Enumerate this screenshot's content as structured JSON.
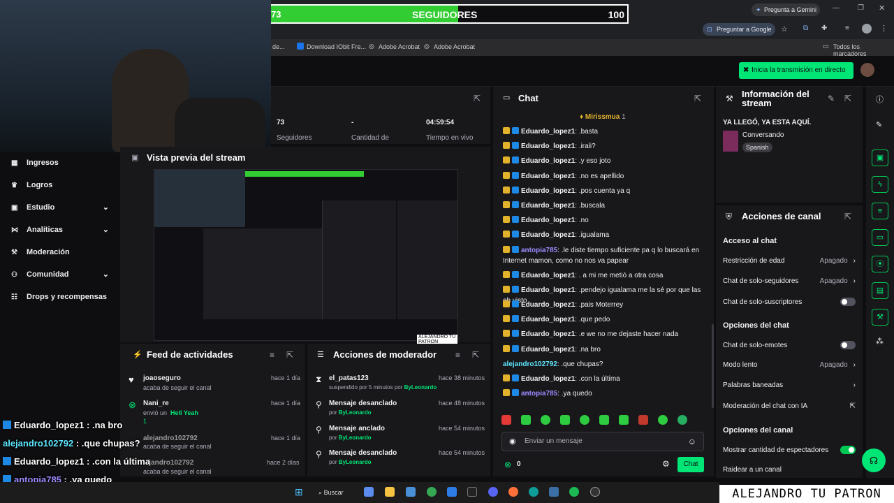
{
  "browser": {
    "gemini_button": "Pregunta a Gemini",
    "google_button": "Preguntar a Google",
    "bookmarks": [
      "de...",
      "Download IObit Fre...",
      "Adobe Acrobat",
      "Adobe Acrobat"
    ],
    "all_bookmarks": "Todos los marcadores"
  },
  "follower_goal": {
    "current": "73",
    "label": "SEGUIDORES",
    "target": "100",
    "progress": 0.73
  },
  "header": {
    "start_stream_button": "Inicia la transmisión en directo"
  },
  "stats": [
    {
      "value": "73",
      "label": "Seguidores"
    },
    {
      "value": "-",
      "label": "Cantidad de"
    },
    {
      "value": "04:59:54",
      "label": "Tiempo en vivo"
    }
  ],
  "preview": {
    "title": "Vista previa del stream",
    "watermark": "ALEJANDRO TU PATRON"
  },
  "sidebar": {
    "items": [
      {
        "label": "Ingresos"
      },
      {
        "label": "Logros"
      },
      {
        "label": "Estudio"
      },
      {
        "label": "Analíticas"
      },
      {
        "label": "Moderación"
      },
      {
        "label": "Comunidad"
      },
      {
        "label": "Drops y recompensas"
      }
    ]
  },
  "activity": {
    "title": "Feed de actividades",
    "items": [
      {
        "name": "joaoseguro",
        "action": "acaba de seguir el canal",
        "time": "hace 1 día"
      },
      {
        "name": "Nani_re",
        "action": "envió un",
        "highlight": "Hell Yeah",
        "points": "1",
        "time": "hace 1 día"
      },
      {
        "name": "alejandro102792",
        "action": "acaba de seguir el canal",
        "time": "hace 1 día"
      },
      {
        "name": "...jandro102792",
        "action": "acaba de seguir el canal",
        "time": "hace 2 días"
      }
    ]
  },
  "mod_actions": {
    "title": "Acciones de moderador",
    "items": [
      {
        "name": "el_patas123",
        "detail": "suspendido por 5 minutos por",
        "by": "ByLeonardo",
        "time": "hace 38 minutos"
      },
      {
        "name": "Mensaje desanclado",
        "detail": "por",
        "by": "ByLeonardo",
        "time": "hace 48 minutos"
      },
      {
        "name": "Mensaje anclado",
        "detail": "por",
        "by": "ByLeonardo",
        "time": "hace 54 minutos"
      },
      {
        "name": "Mensaje desanclado",
        "detail": "por",
        "by": "ByLeonardo",
        "time": "hace 54 minutos"
      }
    ]
  },
  "chat": {
    "title": "Chat",
    "top_gifter": "Mirissmua",
    "top_gifter_count": "1",
    "messages": [
      {
        "badge": "gold",
        "user": "Eduardo_lopez1",
        "color": "#efeff1",
        "text": ": .basta"
      },
      {
        "badge": "gold",
        "user": "Eduardo_lopez1",
        "color": "#efeff1",
        "text": ": .irali?"
      },
      {
        "badge": "gold",
        "user": "Eduardo_lopez1",
        "color": "#efeff1",
        "text": ": .y eso joto"
      },
      {
        "badge": "gold",
        "user": "Eduardo_lopez1",
        "color": "#efeff1",
        "text": ": .no es apellido"
      },
      {
        "badge": "gold",
        "user": "Eduardo_lopez1",
        "color": "#efeff1",
        "text": ": .pos cuenta ya q"
      },
      {
        "badge": "gold",
        "user": "Eduardo_lopez1",
        "color": "#efeff1",
        "text": ": .buscala"
      },
      {
        "badge": "gold",
        "user": "Eduardo_lopez1",
        "color": "#efeff1",
        "text": ": .no"
      },
      {
        "badge": "gold",
        "user": "Eduardo_lopez1",
        "color": "#efeff1",
        "text": ": .igualama"
      },
      {
        "badge": "gold",
        "user": "antopia785",
        "color": "#9b8cff",
        "text": ": .le diste tiempo suficiente pa q lo buscará en Internet mamon, como no nos va papear"
      },
      {
        "badge": "gold",
        "user": "Eduardo_lopez1",
        "color": "#efeff1",
        "text": ": . a mi me metió a otra cosa"
      },
      {
        "badge": "gold",
        "user": "Eduardo_lopez1",
        "color": "#efeff1",
        "text": ": .pendejo igualama me la sé por que las eh visto"
      },
      {
        "badge": "gold",
        "user": "Eduardo_lopez1",
        "color": "#efeff1",
        "text": ": .pais Moterrey"
      },
      {
        "badge": "gold",
        "user": "Eduardo_lopez1",
        "color": "#efeff1",
        "text": ": .que pedo"
      },
      {
        "badge": "gold",
        "user": "Eduardo_lopez1",
        "color": "#efeff1",
        "text": ": .e we no me dejaste hacer nada"
      },
      {
        "badge": "gold",
        "user": "Eduardo_lopez1",
        "color": "#efeff1",
        "text": ": .na bro"
      },
      {
        "badge": "none",
        "user": "alejandro102792",
        "color": "#5ee8ff",
        "text": ": .que chupas?"
      },
      {
        "badge": "gold",
        "user": "Eduardo_lopez1",
        "color": "#efeff1",
        "text": ": .con la última"
      },
      {
        "badge": "gold",
        "user": "antopia785",
        "color": "#9b8cff",
        "text": ": .ya quedo"
      }
    ],
    "input_placeholder": "Enviar un mensaje",
    "points": "0",
    "send_button": "Chat"
  },
  "stream_info": {
    "title": "Información del stream",
    "stream_title": "YA LLEGÓ, YA ESTA AQUÍ.",
    "category": "Conversando",
    "language": "Spanish"
  },
  "channel_actions": {
    "title": "Acciones de canal",
    "sections": [
      {
        "heading": "Acceso al chat"
      },
      {
        "heading": "Opciones del chat"
      },
      {
        "heading": "Opciones del canal"
      }
    ],
    "age_restriction": {
      "label": "Restricción de edad",
      "value": "Apagado"
    },
    "followers_only": {
      "label": "Chat de solo-seguidores",
      "value": "Apagado"
    },
    "subs_only": {
      "label": "Chat de solo-suscriptores",
      "on": false
    },
    "emote_only": {
      "label": "Chat de solo-emotes",
      "on": false
    },
    "slow_mode": {
      "label": "Modo lento",
      "value": "Apagado"
    },
    "banned_words": {
      "label": "Palabras baneadas"
    },
    "ai_moderation": {
      "label": "Moderación del chat con IA"
    },
    "show_viewers": {
      "label": "Mostrar cantidad de espectadores",
      "on": true
    },
    "raid": {
      "label": "Raidear a un canal"
    }
  },
  "overlay_chat": [
    {
      "user": "Eduardo_lopez1",
      "color": "#ffffff",
      "text": " : .na bro"
    },
    {
      "user": "alejandro102792",
      "color": "#5ee8ff",
      "text": " : .que chupas?"
    },
    {
      "user": "Eduardo_lopez1",
      "color": "#ffffff",
      "text": " : .con la última"
    },
    {
      "user": "antopia785",
      "color": "#9b8cff",
      "text": " : .ya quedo"
    }
  ],
  "taskbar": {
    "search": "Buscar"
  },
  "watermark": "ALEJANDRO TU PATRON"
}
